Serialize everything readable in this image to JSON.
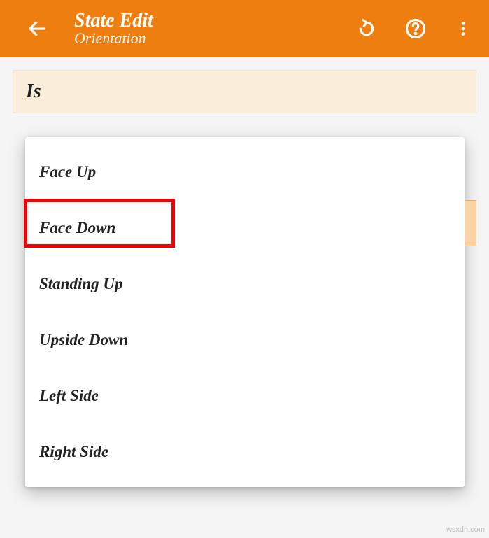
{
  "header": {
    "title": "State Edit",
    "subtitle": "Orientation"
  },
  "section": {
    "label": "Is"
  },
  "options": [
    "Face Up",
    "Face Down",
    "Standing Up",
    "Upside Down",
    "Left Side",
    "Right Side"
  ],
  "highlighted_index": 1,
  "watermark": "wsxdn.com"
}
